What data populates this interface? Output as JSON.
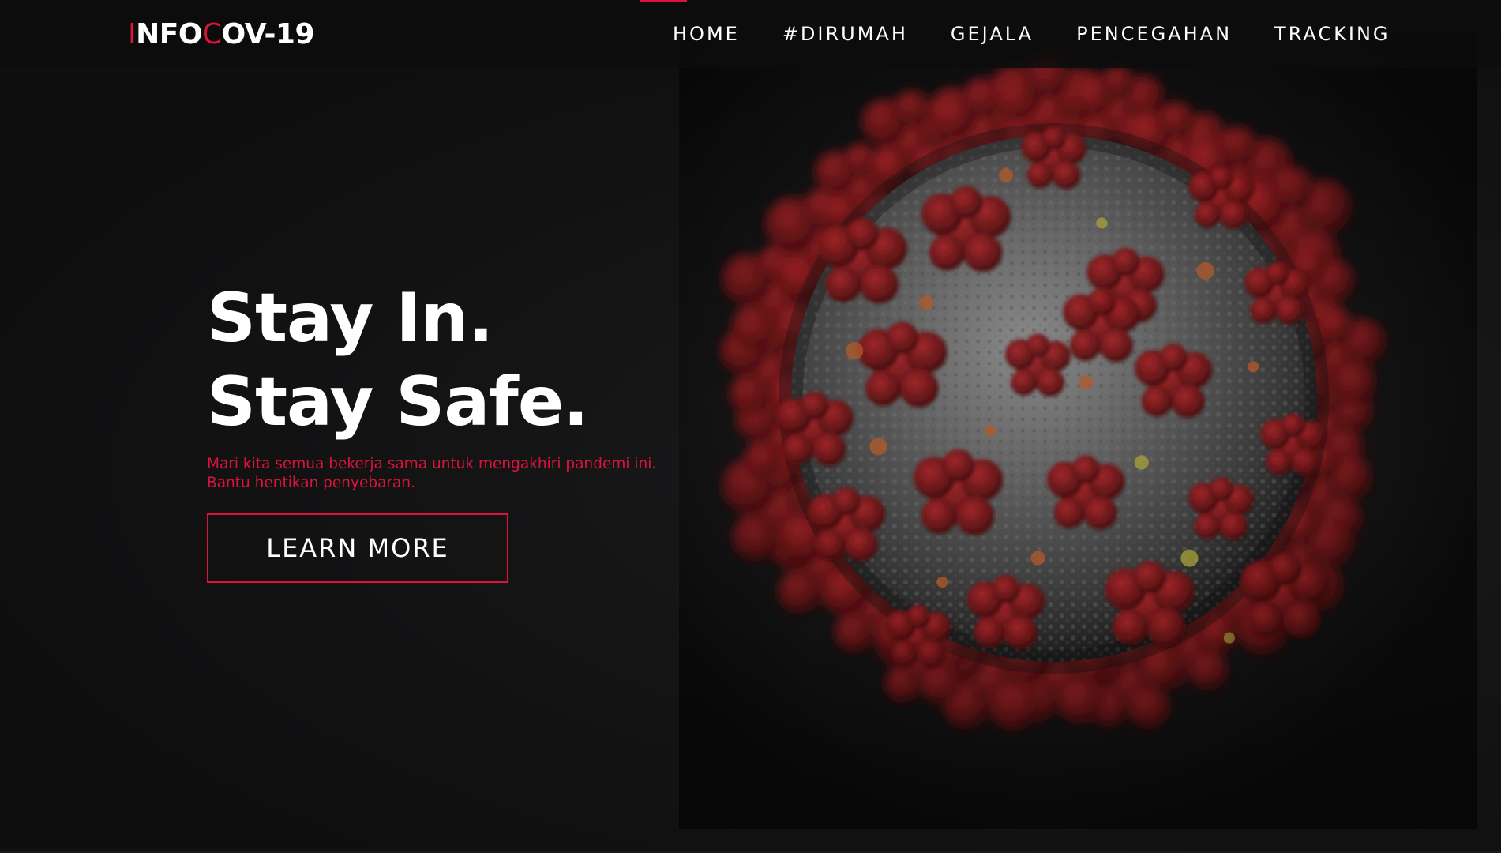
{
  "nav": {
    "brand_parts": [
      "I",
      "NFO",
      "C",
      "OV-19"
    ],
    "links": [
      "HOME",
      "#DIRUMAH",
      "GEJALA",
      "PENCEGAHAN",
      "TRACKING"
    ],
    "active_link": "HOME"
  },
  "hero": {
    "line1": "Stay In.",
    "line2": "Stay Safe.",
    "subtitle_line1": "Mari kita semua bekerja sama untuk mengakhiri pandemi ini.",
    "subtitle_line2": "Bantu hentikan penyebaran.",
    "button_label": "LEARN MORE"
  },
  "colors": {
    "accent": "#dc143c",
    "background": "#0f0f10",
    "text": "#ffffff",
    "virus_body": "#6a6a6a",
    "virus_spike": "#7a1a1c"
  },
  "icons": {
    "hero_image": "coronavirus-illustration"
  }
}
